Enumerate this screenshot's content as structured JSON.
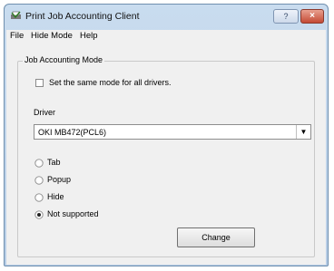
{
  "window": {
    "title": "Print Job Accounting Client",
    "help_button": "?",
    "close_button": "×"
  },
  "menu": [
    "File",
    "Hide Mode",
    "Help"
  ],
  "group": {
    "label": "Job Accounting Mode",
    "same_mode_checkbox": {
      "label": "Set the same mode for all drivers.",
      "checked": false
    },
    "driver_label": "Driver",
    "driver_select": {
      "value": "OKI MB472(PCL6)"
    },
    "radio_options": [
      {
        "label": "Tab",
        "selected": false
      },
      {
        "label": "Popup",
        "selected": false
      },
      {
        "label": "Hide",
        "selected": false
      },
      {
        "label": "Not supported",
        "selected": true
      }
    ]
  },
  "buttons": {
    "change": "Change"
  }
}
